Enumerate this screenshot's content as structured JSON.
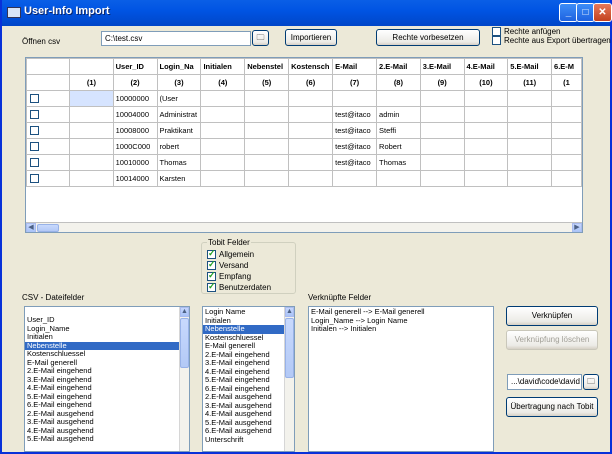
{
  "window": {
    "title": "User-Info Import"
  },
  "top": {
    "open_label": "Öffnen csv",
    "path_value": "C:\\test.csv",
    "import_button": "Importieren",
    "rights_preset_button": "Rechte vorbesetzen",
    "rights_append_label": "Rechte anfügen",
    "rights_export_label": "Rechte aus Export übertragen"
  },
  "grid": {
    "headers": [
      "",
      "",
      "User_ID",
      "Login_Na",
      "Initialen",
      "Nebenstel",
      "Kostensch",
      "E-Mail",
      "2.E-Mail",
      "3.E-Mail",
      "4.E-Mail",
      "5.E-Mail",
      "6.E-M"
    ],
    "numbers": [
      "",
      "(1)",
      "(2)",
      "(3)",
      "(4)",
      "(5)",
      "(6)",
      "(7)",
      "(8)",
      "(9)",
      "(10)",
      "(11)",
      "(1"
    ],
    "rows": [
      [
        "10000000",
        "(User",
        "",
        "",
        "",
        "",
        ""
      ],
      [
        "10004000",
        "Administrat",
        "",
        "",
        "",
        "test@itaco",
        "admin"
      ],
      [
        "10008000",
        "Praktikant",
        "",
        "",
        "",
        "test@itaco",
        "Steffi"
      ],
      [
        "1000C000",
        "robert",
        "",
        "",
        "",
        "test@itaco",
        "Robert"
      ],
      [
        "10010000",
        "Thomas",
        "",
        "",
        "",
        "test@itaco",
        "Thomas"
      ],
      [
        "10014000",
        "Karsten",
        "",
        "",
        "",
        "",
        ""
      ]
    ]
  },
  "tobit": {
    "title": "Tobit Felder",
    "options": [
      {
        "label": "Allgemein",
        "checked": true
      },
      {
        "label": "Versand",
        "checked": true
      },
      {
        "label": "Empfang",
        "checked": true
      },
      {
        "label": "Benutzerdaten",
        "checked": true
      }
    ]
  },
  "csv_fields": {
    "title": "CSV - Dateifelder",
    "items": [
      "User_ID",
      "Login_Name",
      "Initialen",
      "Nebenstelle",
      "Kostenschluessel",
      "E-Mail generell",
      "2.E-Mail eingehend",
      "3.E-Mail eingehend",
      "4.E-Mail eingehend",
      "5.E-Mail eingehend",
      "6.E-Mail eingehend",
      "2.E-Mail ausgehend",
      "3.E-Mail ausgehend",
      "4.E-Mail ausgehend",
      "5.E-Mail ausgehend"
    ],
    "selected": "Nebenstelle"
  },
  "tobit_fields": {
    "items": [
      "Login Name",
      "Initialen",
      "Nebenstelle",
      "Kostenschluessel",
      "E-Mail generell",
      "2.E-Mail eingehend",
      "3.E-Mail eingehend",
      "4.E-Mail eingehend",
      "5.E-Mail eingehend",
      "6.E-Mail eingehend",
      "2.E-Mail ausgehend",
      "3.E-Mail ausgehend",
      "4.E-Mail ausgehend",
      "5.E-Mail ausgehend",
      "6.E-Mail ausgehend",
      "Unterschrift"
    ],
    "selected": "Nebenstelle"
  },
  "linked": {
    "title": "Verknüpfte Felder",
    "items": [
      "E-Mail generell --> E-Mail generell",
      "Login_Name --> Login Name",
      "Initialen --> Initialen"
    ]
  },
  "actions": {
    "link_button": "Verknüpfen",
    "unlink_button": "Verknüpfung löschen",
    "target_path": "...\\david\\code\\david",
    "transfer_button": "Übertragung nach Tobit"
  },
  "colors": {
    "titlebar": "#0054e3",
    "selection": "#316ac5"
  }
}
